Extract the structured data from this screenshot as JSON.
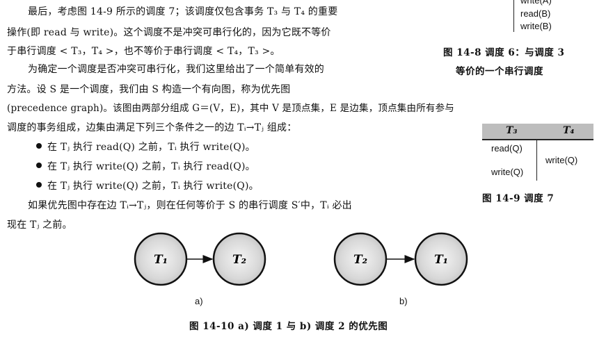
{
  "top_right_ops": [
    "write(A)",
    "read(B)",
    "write(B)"
  ],
  "fig14_8": {
    "line1": "图 14-8   调度 6：与调度 3",
    "line2": "等价的一个串行调度"
  },
  "para1": {
    "l1": "最后，考虑图 14-9 所示的调度 7；该调度仅包含事务 T₃ 与 T₄ 的重要",
    "l2": "操作(即 read 与 write)。这个调度不是冲突可串行化的，因为它既不等价",
    "l3": "于串行调度 < T₃，T₄ >，也不等价于串行调度 < T₄，T₃ >。"
  },
  "para2": {
    "l1": "为确定一个调度是否冲突可串行化，我们这里给出了一个简单有效的",
    "l2": "方法。设 S 是一个调度，我们由 S 构造一个有向图，称为优先图",
    "l3": "(precedence graph)。该图由两部分组成 G＝(V，E)，其中 V 是顶点集，E 是边集，顶点集由所有参与",
    "l4": "调度的事务组成，边集由满足下列三个条件之一的边 Tᵢ→Tⱼ 组成："
  },
  "bullets": [
    "在 Tⱼ 执行 read(Q) 之前，Tᵢ 执行 write(Q)。",
    "在 Tⱼ 执行 write(Q) 之前，Tᵢ 执行 read(Q)。",
    "在 Tⱼ 执行 write(Q) 之前，Tᵢ 执行 write(Q)。"
  ],
  "para3": {
    "l1": "如果优先图中存在边 Tᵢ→Tⱼ，则在任何等价于 S 的串行调度 S′中，Tᵢ 必出",
    "l2": "现在 Tⱼ 之前。"
  },
  "fig14_9": {
    "headers": [
      "T₃",
      "T₄"
    ],
    "t3_ops": [
      "read(Q)",
      "write(Q)"
    ],
    "t4_ops": [
      "write(Q)"
    ],
    "caption": "图 14-9   调度 7"
  },
  "fig14_10": {
    "graph_a": {
      "from": "T₁",
      "to": "T₂",
      "label": "a)"
    },
    "graph_b": {
      "from": "T₂",
      "to": "T₁",
      "label": "b)"
    },
    "caption": "图 14-10   a) 调度 1 与 b) 调度 2 的优先图"
  }
}
